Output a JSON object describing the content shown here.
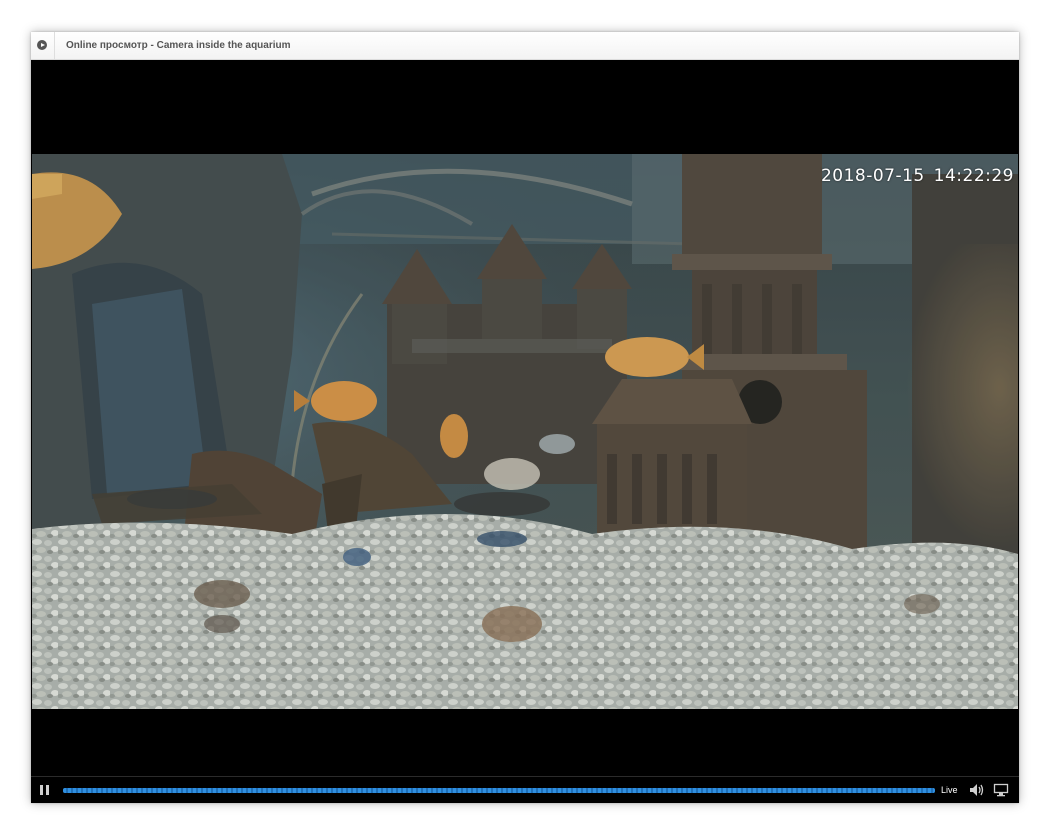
{
  "window": {
    "title": "Online просмотр - Camera inside the aquarium"
  },
  "video": {
    "timestamp": "2018-07-15   14:22:29",
    "scene": "underwater-aquarium-camera-feed"
  },
  "controls": {
    "pause_icon": "pause-icon",
    "progress": 1.0,
    "live_label": "Live",
    "volume_icon": "volume-icon",
    "screen_icon": "screen-icon"
  },
  "colors": {
    "accent": "#2f8fe0",
    "player_bg": "#000000",
    "title_text": "#555555"
  }
}
